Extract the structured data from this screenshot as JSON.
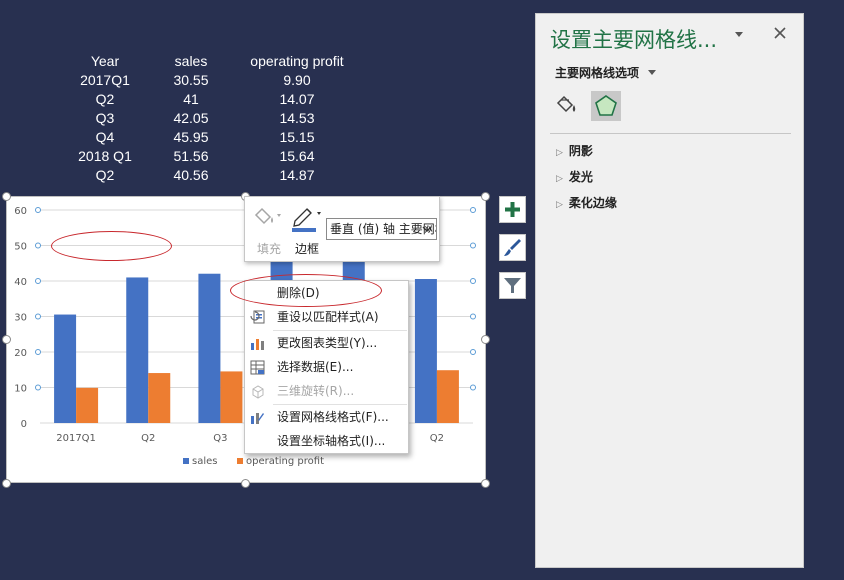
{
  "table": {
    "headers": [
      "Year",
      "sales",
      "operating profit"
    ],
    "rows": [
      [
        "2017Q1",
        "30.55",
        "9.90"
      ],
      [
        "Q2",
        "41",
        "14.07"
      ],
      [
        "Q3",
        "42.05",
        "14.53"
      ],
      [
        "Q4",
        "45.95",
        "15.15"
      ],
      [
        "2018 Q1",
        "51.56",
        "15.64"
      ],
      [
        "Q2",
        "40.56",
        "14.87"
      ]
    ]
  },
  "chart_data": {
    "type": "bar",
    "categories": [
      "2017Q1",
      "Q2",
      "Q3",
      "Q4",
      "2018 Q1",
      "Q2"
    ],
    "visible_category_labels": [
      "2017Q1",
      "Q2",
      "Q3",
      "",
      "",
      "Q2"
    ],
    "series": [
      {
        "name": "sales",
        "values": [
          30.55,
          41,
          42.05,
          45.95,
          51.56,
          40.56
        ],
        "color": "#4472c4"
      },
      {
        "name": "operating profit",
        "values": [
          9.9,
          14.07,
          14.53,
          15.15,
          15.64,
          14.87
        ],
        "color": "#ed7d31"
      }
    ],
    "ylim": [
      0,
      60
    ],
    "yticks": [
      0,
      10,
      20,
      30,
      40,
      50,
      60
    ],
    "grid": true,
    "legend_position": "bottom",
    "selected_element": "major gridlines"
  },
  "mini_toolbar": {
    "fill_label": "填充",
    "border_label": "边框",
    "element_select": "垂直 (值) 轴 主要网格线"
  },
  "context_menu": {
    "items": [
      {
        "label": "删除(D)",
        "enabled": true,
        "icon": ""
      },
      {
        "label": "重设以匹配样式(A)",
        "enabled": true,
        "icon": "reset-style-icon"
      },
      {
        "label": "更改图表类型(Y)...",
        "enabled": true,
        "icon": "chart-type-icon"
      },
      {
        "label": "选择数据(E)...",
        "enabled": true,
        "icon": "select-data-icon"
      },
      {
        "label": "三维旋转(R)...",
        "enabled": false,
        "icon": "3d-rotation-icon"
      },
      {
        "label": "设置网格线格式(F)...",
        "enabled": true,
        "icon": "format-gridlines-icon"
      },
      {
        "label": "设置坐标轴格式(I)...",
        "enabled": true,
        "icon": ""
      }
    ]
  },
  "side_buttons": [
    "chart-elements-icon",
    "chart-styles-icon",
    "chart-filters-icon"
  ],
  "pane": {
    "title": "设置主要网格线...",
    "subtitle": "主要网格线选项",
    "tabs": [
      "fill-line-icon",
      "effects-icon"
    ],
    "sections": [
      "阴影",
      "发光",
      "柔化边缘"
    ]
  },
  "colors": {
    "background": "#283050",
    "sales": "#4472c4",
    "operating_profit": "#ed7d31",
    "pane_title": "#217346",
    "annotation": "#c8282d"
  }
}
